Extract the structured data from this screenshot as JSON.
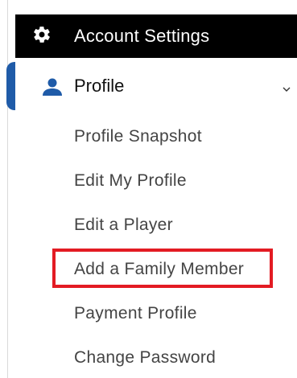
{
  "menu": {
    "header": {
      "label": "Account Settings",
      "icon": "gear-icon"
    },
    "profile": {
      "label": "Profile",
      "icon": "user-icon",
      "expanded": true,
      "accent_color": "#1f5ba8"
    },
    "items": [
      {
        "label": "Profile Snapshot"
      },
      {
        "label": "Edit My Profile"
      },
      {
        "label": "Edit a Player"
      },
      {
        "label": "Add a Family Member",
        "highlighted": true
      },
      {
        "label": "Payment Profile"
      },
      {
        "label": "Change Password"
      }
    ],
    "highlight_color": "#e31b23"
  }
}
